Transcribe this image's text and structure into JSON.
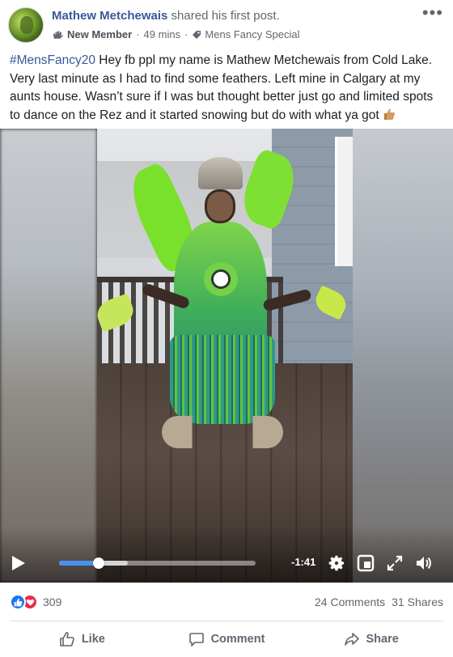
{
  "post": {
    "author": "Mathew Metchewais",
    "action": "shared his first post.",
    "badge": "New Member",
    "time": "49 mins",
    "separator": "·",
    "group": "Mens Fancy Special",
    "more": "•••",
    "hashtag": "#MensFancy20",
    "text": " Hey fb ppl my name is Mathew Metchewais from Cold Lake. Very last minute as I had to find some feathers. Left mine in Calgary at my aunts house. Wasn’t sure if I was but thought better just go and limited spots to dance on the Rez and it started snowing but do with what ya got "
  },
  "video": {
    "time_remaining": "-1:41",
    "progress_fraction": 0.2,
    "buffered_fraction": 0.35
  },
  "stats": {
    "reaction_count": "309",
    "comments": "24 Comments",
    "shares": "31 Shares"
  },
  "actions": {
    "like": "Like",
    "comment": "Comment",
    "share": "Share"
  },
  "colors": {
    "link": "#385898",
    "like_blue": "#1877f2",
    "love_red": "#f0284a",
    "progress": "#4a90f0"
  }
}
